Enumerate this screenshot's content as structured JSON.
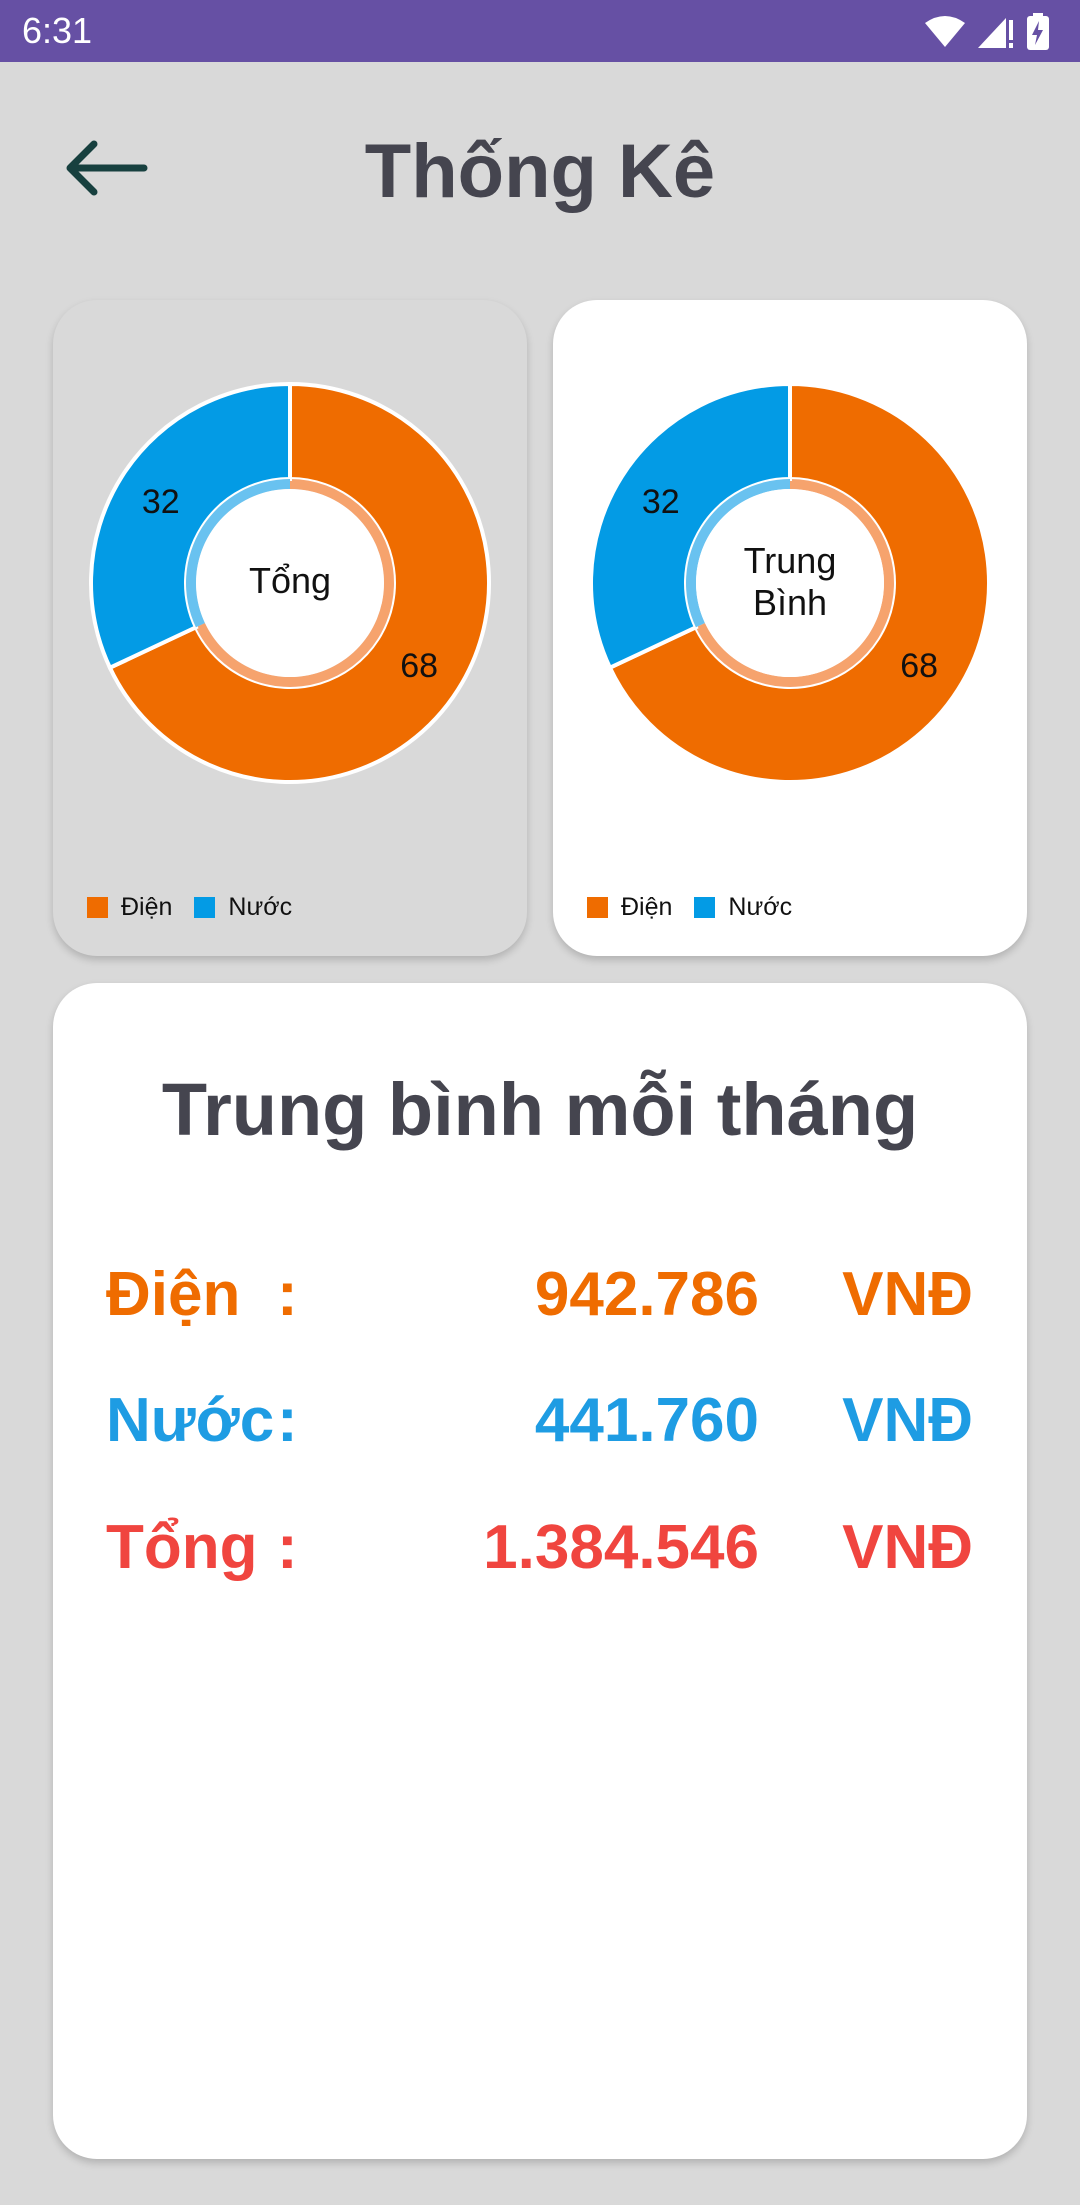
{
  "status_bar": {
    "time": "6:31"
  },
  "header": {
    "title": "Thống Kê"
  },
  "colors": {
    "dien": "#ef6c00",
    "nuoc": "#039be5",
    "tong": "#f0453f",
    "status_bar": "#6650a4"
  },
  "icons": {
    "back": "arrow-left-icon",
    "wifi": "wifi-icon",
    "signal": "signal-icon",
    "battery": "battery-charging-icon"
  },
  "chart_data": [
    {
      "type": "pie",
      "categories": [
        "Điện",
        "Nước"
      ],
      "values": [
        68,
        32
      ],
      "center_label": "Tổng",
      "legend_position": "bottom-left"
    },
    {
      "type": "pie",
      "categories": [
        "Điện",
        "Nước"
      ],
      "values": [
        68,
        32
      ],
      "center_label": "Trung Bình",
      "legend_position": "bottom-left"
    }
  ],
  "legend": {
    "dien": "Điện",
    "nuoc": "Nước"
  },
  "summary": {
    "title": "Trung bình mỗi tháng",
    "rows": [
      {
        "label": "Điện",
        "colon": ":",
        "value": "942.786",
        "unit": "VNĐ"
      },
      {
        "label": "Nước",
        "colon": ":",
        "value": "441.760",
        "unit": "VNĐ"
      },
      {
        "label": "Tổng",
        "colon": ":",
        "value": "1.384.546",
        "unit": "VNĐ"
      }
    ]
  }
}
